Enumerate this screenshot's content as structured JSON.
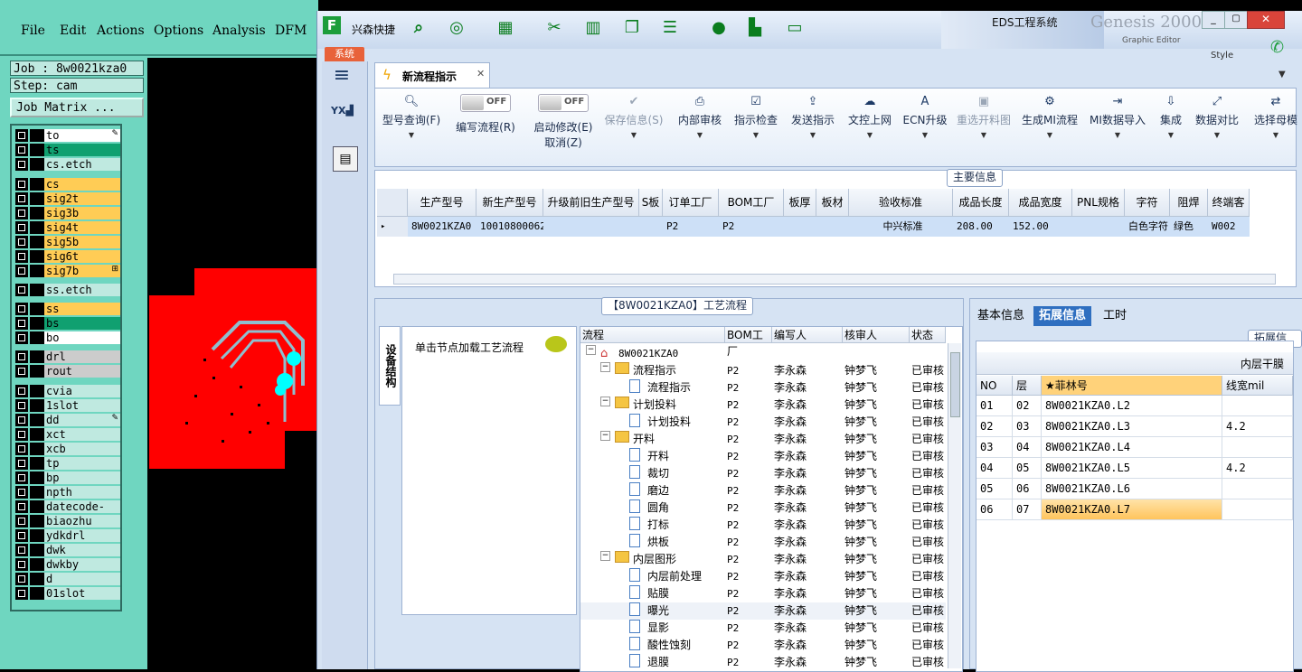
{
  "genesis": {
    "menu": [
      "File",
      "Edit",
      "Actions",
      "Options",
      "Analysis",
      "DFM"
    ],
    "job_label": "Job : 8w0021kza0",
    "step_label": "Step: cam",
    "job_matrix_label": "Job Matrix ...",
    "layers": [
      {
        "name": "to",
        "color": "#ffffff",
        "mark": "✎"
      },
      {
        "name": "ts",
        "color": "#10a070",
        "mark": ""
      },
      {
        "name": "cs.etch",
        "color": "#bfe9e0",
        "mark": ""
      },
      {
        "name": "cs",
        "color": "#ffcc55",
        "mark": ""
      },
      {
        "name": "sig2t",
        "color": "#ffcc55",
        "mark": ""
      },
      {
        "name": "sig3b",
        "color": "#ffcc55",
        "mark": ""
      },
      {
        "name": "sig4t",
        "color": "#ffcc55",
        "mark": ""
      },
      {
        "name": "sig5b",
        "color": "#ffcc55",
        "mark": ""
      },
      {
        "name": "sig6t",
        "color": "#ffcc55",
        "mark": ""
      },
      {
        "name": "sig7b",
        "color": "#ffcc55",
        "mark": "⊞"
      },
      {
        "name": "ss.etch",
        "color": "#bfe9e0",
        "mark": ""
      },
      {
        "name": "ss",
        "color": "#ffcc55",
        "mark": ""
      },
      {
        "name": "bs",
        "color": "#10a070",
        "mark": ""
      },
      {
        "name": "bo",
        "color": "#ffffff",
        "mark": ""
      },
      {
        "name": "drl",
        "color": "#cccccc",
        "mark": ""
      },
      {
        "name": "rout",
        "color": "#cccccc",
        "mark": ""
      },
      {
        "name": "cvia",
        "color": "#bfe9e0",
        "mark": ""
      },
      {
        "name": "1slot",
        "color": "#bfe9e0",
        "mark": ""
      },
      {
        "name": "dd",
        "color": "#bfe9e0",
        "mark": "✎"
      },
      {
        "name": "xct",
        "color": "#bfe9e0",
        "mark": ""
      },
      {
        "name": "xcb",
        "color": "#bfe9e0",
        "mark": ""
      },
      {
        "name": "tp",
        "color": "#bfe9e0",
        "mark": ""
      },
      {
        "name": "bp",
        "color": "#bfe9e0",
        "mark": ""
      },
      {
        "name": "npth",
        "color": "#bfe9e0",
        "mark": ""
      },
      {
        "name": "datecode-pte",
        "color": "#bfe9e0",
        "mark": ""
      },
      {
        "name": "biaozhu",
        "color": "#bfe9e0",
        "mark": ""
      },
      {
        "name": "ydkdrl",
        "color": "#bfe9e0",
        "mark": ""
      },
      {
        "name": "dwk",
        "color": "#bfe9e0",
        "mark": ""
      },
      {
        "name": "dwkby",
        "color": "#bfe9e0",
        "mark": ""
      },
      {
        "name": "d",
        "color": "#bfe9e0",
        "mark": ""
      },
      {
        "name": "01slot",
        "color": "#bfe9e0",
        "mark": ""
      }
    ],
    "bg_title": "Genesis 2000",
    "bg_sub": "Graphic Editor",
    "bg_style": "Style"
  },
  "eds": {
    "app_name": "兴森快捷",
    "window_title": "EDS工程系统",
    "system_button": "系统",
    "tab_label": "新流程指示",
    "ribbon": [
      {
        "label": "型号查询(F)",
        "icon": "search-icon",
        "disabled": false
      },
      {
        "label": "编写流程(R)",
        "icon": "toggle",
        "disabled": false,
        "toggle": "OFF"
      },
      {
        "label": "启动修改(E)",
        "label2": "取消(Z)",
        "icon": "toggle",
        "disabled": false,
        "toggle": "OFF"
      },
      {
        "label": "保存信息(S)",
        "icon": "check-icon",
        "disabled": true
      },
      {
        "label": "内部审核",
        "icon": "printer-icon",
        "disabled": false
      },
      {
        "label": "指示检查",
        "icon": "checkbox-icon",
        "disabled": false
      },
      {
        "label": "发送指示",
        "icon": "upload-icon",
        "disabled": false
      },
      {
        "label": "文控上网",
        "icon": "cloud-icon",
        "disabled": false
      },
      {
        "label": "ECN升级",
        "icon": "ecn-icon",
        "disabled": false
      },
      {
        "label": "重选开料图",
        "icon": "image-icon",
        "disabled": true
      },
      {
        "label": "生成MI流程",
        "icon": "gears-icon",
        "disabled": false
      },
      {
        "label": "MI数据导入",
        "icon": "import-icon",
        "disabled": false
      },
      {
        "label": "集成",
        "icon": "download-icon",
        "disabled": false
      },
      {
        "label": "数据对比",
        "icon": "compare-icon",
        "disabled": false
      },
      {
        "label": "选择母模",
        "icon": "shuffle-icon",
        "disabled": false
      }
    ],
    "main_info": {
      "title": "主要信息",
      "columns": [
        "生产型号",
        "新生产型号",
        "升级前旧生产型号",
        "S板",
        "订单工厂",
        "BOM工厂",
        "板厚",
        "板材",
        "验收标准",
        "成品长度",
        "成品宽度",
        "PNL规格",
        "字符",
        "阻焊",
        "终端客"
      ],
      "row": [
        "8W0021KZA0",
        "10010800062679",
        "",
        "",
        "P2",
        "P2",
        "",
        "",
        "中兴标准",
        "208.00",
        "152.00",
        "",
        "白色字符",
        "绿色",
        "W002"
      ]
    },
    "process": {
      "title": "【8W0021KZA0】工艺流程",
      "vertical_tab": "设备结构",
      "node_hint": "单击节点加载工艺流程",
      "columns": [
        "流程",
        "BOM工厂",
        "编写人",
        "核审人",
        "状态"
      ],
      "root": "8W0021KZA0",
      "rows": [
        {
          "name": "流程指示",
          "level": 1,
          "factory": "P2",
          "writer": "李永森",
          "reviewer": "钟梦飞",
          "status": "已审核"
        },
        {
          "name": "流程指示",
          "level": 2,
          "factory": "P2",
          "writer": "李永森",
          "reviewer": "钟梦飞",
          "status": "已审核"
        },
        {
          "name": "计划投料",
          "level": 1,
          "factory": "P2",
          "writer": "李永森",
          "reviewer": "钟梦飞",
          "status": "已审核"
        },
        {
          "name": "计划投料",
          "level": 2,
          "factory": "P2",
          "writer": "李永森",
          "reviewer": "钟梦飞",
          "status": "已审核"
        },
        {
          "name": "开料",
          "level": 1,
          "factory": "P2",
          "writer": "李永森",
          "reviewer": "钟梦飞",
          "status": "已审核"
        },
        {
          "name": "开料",
          "level": 2,
          "factory": "P2",
          "writer": "李永森",
          "reviewer": "钟梦飞",
          "status": "已审核"
        },
        {
          "name": "裁切",
          "level": 2,
          "factory": "P2",
          "writer": "李永森",
          "reviewer": "钟梦飞",
          "status": "已审核"
        },
        {
          "name": "磨边",
          "level": 2,
          "factory": "P2",
          "writer": "李永森",
          "reviewer": "钟梦飞",
          "status": "已审核"
        },
        {
          "name": "圆角",
          "level": 2,
          "factory": "P2",
          "writer": "李永森",
          "reviewer": "钟梦飞",
          "status": "已审核"
        },
        {
          "name": "打标",
          "level": 2,
          "factory": "P2",
          "writer": "李永森",
          "reviewer": "钟梦飞",
          "status": "已审核"
        },
        {
          "name": "烘板",
          "level": 2,
          "factory": "P2",
          "writer": "李永森",
          "reviewer": "钟梦飞",
          "status": "已审核"
        },
        {
          "name": "内层图形",
          "level": 1,
          "factory": "P2",
          "writer": "李永森",
          "reviewer": "钟梦飞",
          "status": "已审核"
        },
        {
          "name": "内层前处理",
          "level": 2,
          "factory": "P2",
          "writer": "李永森",
          "reviewer": "钟梦飞",
          "status": "已审核"
        },
        {
          "name": "贴膜",
          "level": 2,
          "factory": "P2",
          "writer": "李永森",
          "reviewer": "钟梦飞",
          "status": "已审核"
        },
        {
          "name": "曝光",
          "level": 2,
          "factory": "P2",
          "writer": "李永森",
          "reviewer": "钟梦飞",
          "status": "已审核"
        },
        {
          "name": "显影",
          "level": 2,
          "factory": "P2",
          "writer": "李永森",
          "reviewer": "钟梦飞",
          "status": "已审核"
        },
        {
          "name": "酸性蚀刻",
          "level": 2,
          "factory": "P2",
          "writer": "李永森",
          "reviewer": "钟梦飞",
          "status": "已审核"
        },
        {
          "name": "退膜",
          "level": 2,
          "factory": "P2",
          "writer": "李永森",
          "reviewer": "钟梦飞",
          "status": "已审核"
        }
      ]
    },
    "right": {
      "tabs": [
        "基本信息",
        "拓展信息",
        "工时"
      ],
      "section_title": "拓展信息",
      "sub_title": "内层干膜",
      "columns": [
        "NO",
        "层",
        "★菲林号",
        "线宽mil"
      ],
      "rows": [
        [
          "01",
          "02",
          "8W0021KZA0.L2",
          ""
        ],
        [
          "02",
          "03",
          "8W0021KZA0.L3",
          "4.2"
        ],
        [
          "03",
          "04",
          "8W0021KZA0.L4",
          ""
        ],
        [
          "04",
          "05",
          "8W0021KZA0.L5",
          "4.2"
        ],
        [
          "05",
          "06",
          "8W0021KZA0.L6",
          ""
        ],
        [
          "06",
          "07",
          "8W0021KZA0.L7",
          ""
        ]
      ]
    },
    "colors": {
      "accent": "#ffd27a",
      "header": "#d6e3f3",
      "selected": "#cde0f7",
      "system": "#e8623a"
    }
  }
}
